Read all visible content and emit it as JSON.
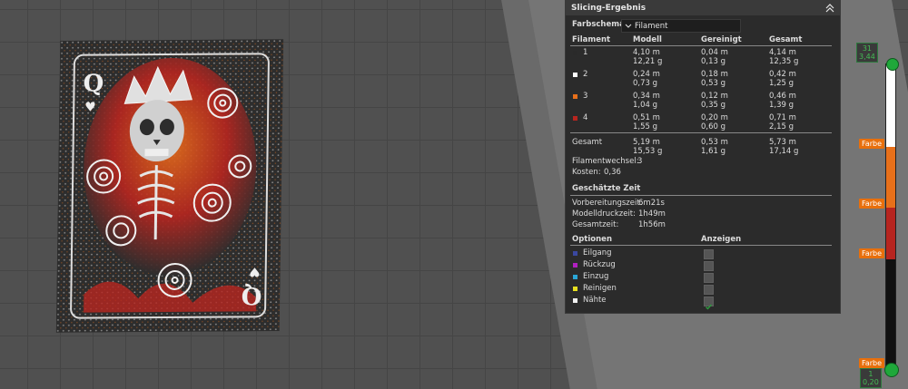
{
  "panel": {
    "title": "Slicing-Ergebnis",
    "color_scheme_label": "Farbschema",
    "color_scheme_value": "Filament",
    "headers": [
      "Filament",
      "Modell",
      "Gereinigt",
      "Gesamt"
    ],
    "filaments": [
      {
        "id": "1",
        "color": "#2a2a2a",
        "model_m": "4,10 m",
        "model_g": "12,21 g",
        "purged_m": "0,04 m",
        "purged_g": "0,13 g",
        "total_m": "4,14 m",
        "total_g": "12,35 g"
      },
      {
        "id": "2",
        "color": "#ffffff",
        "model_m": "0,24 m",
        "model_g": "0,73 g",
        "purged_m": "0,18 m",
        "purged_g": "0,53 g",
        "total_m": "0,42 m",
        "total_g": "1,25 g"
      },
      {
        "id": "3",
        "color": "#e8701a",
        "model_m": "0,34 m",
        "model_g": "1,04 g",
        "purged_m": "0,12 m",
        "purged_g": "0,35 g",
        "total_m": "0,46 m",
        "total_g": "1,39 g"
      },
      {
        "id": "4",
        "color": "#b7251f",
        "model_m": "0,51 m",
        "model_g": "1,55 g",
        "purged_m": "0,20 m",
        "purged_g": "0,60 g",
        "total_m": "0,71 m",
        "total_g": "2,15 g"
      }
    ],
    "total": {
      "label": "Gesamt",
      "model_m": "5,19 m",
      "model_g": "15,53 g",
      "purged_m": "0,53 m",
      "purged_g": "1,61 g",
      "total_m": "5,73 m",
      "total_g": "17,14 g"
    },
    "filament_changes_label": "Filamentwechsel:",
    "filament_changes_value": "3",
    "costs_label": "Kosten:",
    "costs_value": "0,36",
    "time_heading": "Geschätzte Zeit",
    "times": [
      {
        "label": "Vorbereitungszeit:",
        "value": "6m21s"
      },
      {
        "label": "Modelldruckzeit:",
        "value": "1h49m"
      },
      {
        "label": "Gesamtzeit:",
        "value": "1h56m"
      }
    ],
    "options_header": "Optionen",
    "show_header": "Anzeigen",
    "options": [
      {
        "label": "Eilgang",
        "color": "#3a48a0",
        "checked": false
      },
      {
        "label": "Rückzug",
        "color": "#b020c0",
        "checked": false
      },
      {
        "label": "Einzug",
        "color": "#2aa6d6",
        "checked": false
      },
      {
        "label": "Reinigen",
        "color": "#e8e020",
        "checked": false
      },
      {
        "label": "Nähte",
        "color": "#f0f0f0",
        "checked": true
      }
    ]
  },
  "slider": {
    "top_layer": "31",
    "top_height": "3,44",
    "bottom_layer": "1",
    "bottom_height": "0,20",
    "color_label": "Farbe",
    "segments": [
      {
        "color": "#ffffff",
        "fraction": 0.27
      },
      {
        "color": "#e8701a",
        "fraction": 0.2
      },
      {
        "color": "#b7251f",
        "fraction": 0.17
      },
      {
        "color": "#111111",
        "fraction": 0.36
      }
    ],
    "accent": "#e86f0c",
    "handle_color": "#1fa83a"
  },
  "card": {
    "rank": "Q",
    "suit": "♥",
    "colors": {
      "bg": "#2d2d2d",
      "orange": "#e8701a",
      "red": "#b7251f",
      "white": "#eeeeee"
    }
  }
}
